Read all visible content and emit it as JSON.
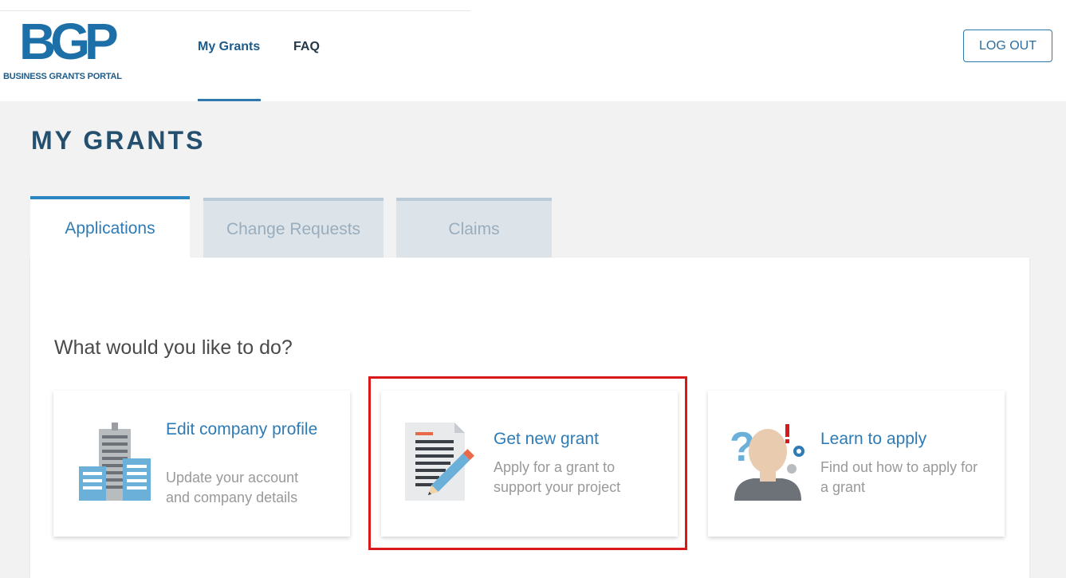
{
  "header": {
    "logo_mark": "BGP",
    "logo_sub": "BUSINESS GRANTS PORTAL",
    "nav": [
      {
        "label": "My Grants",
        "active": true
      },
      {
        "label": "FAQ",
        "active": false
      }
    ],
    "logout_label": "LOG OUT"
  },
  "page": {
    "title": "MY GRANTS"
  },
  "tabs": [
    {
      "label": "Applications",
      "active": true
    },
    {
      "label": "Change Requests",
      "active": false
    },
    {
      "label": "Claims",
      "active": false
    }
  ],
  "main": {
    "question": "What would you like to do?",
    "cards": [
      {
        "title": "Edit company profile",
        "description": "Update your account and company details",
        "icon": "buildings-icon"
      },
      {
        "title": "Get new grant",
        "description": "Apply for a grant to support your project",
        "icon": "document-pencil-icon"
      },
      {
        "title": "Learn to apply",
        "description": "Find out how to apply for a grant",
        "icon": "person-question-icon"
      }
    ]
  },
  "colors": {
    "brand": "#1d6fa8",
    "link": "#2e7bb5",
    "highlight": "#d7191c"
  }
}
